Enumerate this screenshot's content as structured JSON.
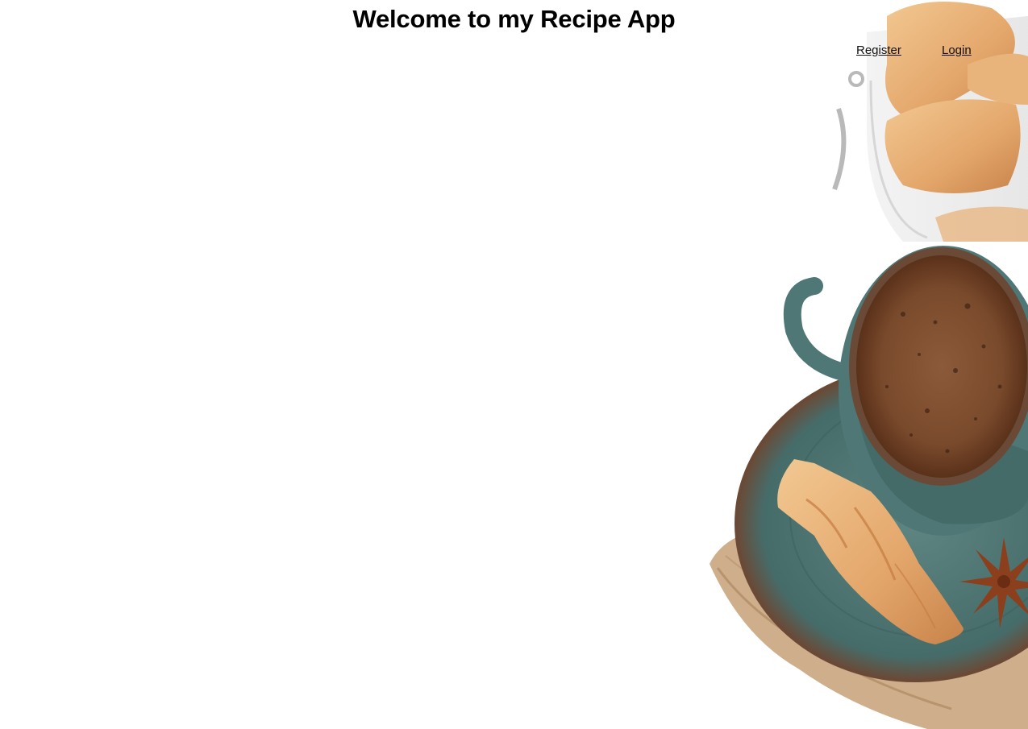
{
  "header": {
    "title": "Welcome to my Recipe App"
  },
  "nav": {
    "register_label": "Register",
    "login_label": "Login"
  },
  "background": {
    "description_icon": "coffee-croissant-photo",
    "colors": {
      "coffee": "#7a4a2c",
      "cup": "#4f7775",
      "croissant": "#e9b27a",
      "burlap": "#c7a27a"
    }
  }
}
